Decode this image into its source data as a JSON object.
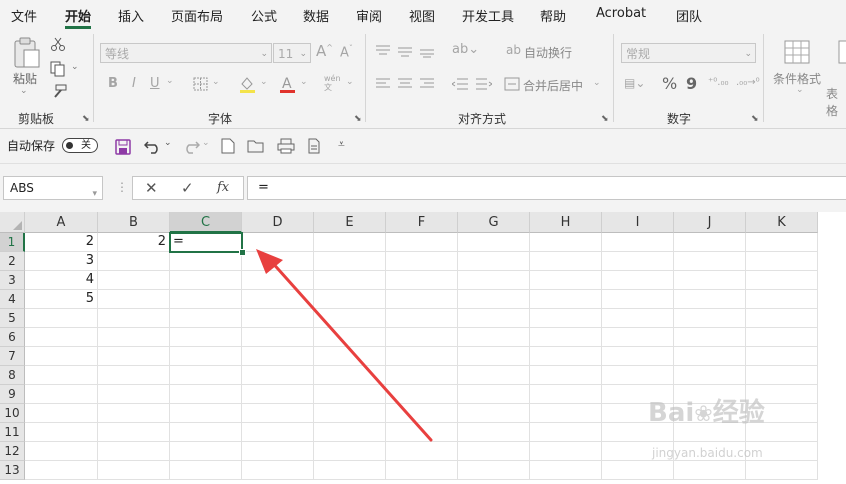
{
  "menu": {
    "items": [
      "文件",
      "开始",
      "插入",
      "页面布局",
      "公式",
      "数据",
      "审阅",
      "视图",
      "开发工具",
      "帮助",
      "Acrobat",
      "团队"
    ],
    "active": "开始"
  },
  "ribbon": {
    "clipboard": {
      "paste_label": "粘贴",
      "group_label": "剪贴板"
    },
    "font": {
      "font_name": "等线",
      "font_size": "11",
      "group_label": "字体",
      "bold": "B",
      "italic": "I",
      "underline": "U",
      "phonetic": "wén"
    },
    "alignment": {
      "wrap_text": "自动换行",
      "merge_center": "合并后居中",
      "group_label": "对齐方式"
    },
    "number": {
      "format": "常规",
      "percent": "%",
      "comma": "9",
      "group_label": "数字"
    },
    "styles": {
      "conditional_format": "条件格式",
      "table_format": "表格"
    }
  },
  "qat": {
    "autosave_label": "自动保存",
    "toggle_state": "关"
  },
  "formula_bar": {
    "name_box": "ABS",
    "fx": "fx",
    "formula": "="
  },
  "columns": [
    "A",
    "B",
    "C",
    "D",
    "E",
    "F",
    "G",
    "H",
    "I",
    "J",
    "K"
  ],
  "rows": [
    "1",
    "2",
    "3",
    "4",
    "5",
    "6",
    "7",
    "8",
    "9",
    "10",
    "11",
    "12",
    "13"
  ],
  "cells": {
    "A1": "2",
    "A2": "3",
    "A3": "4",
    "A4": "5",
    "B1": "2",
    "C1": "="
  },
  "selected": {
    "column": "C",
    "row": "1"
  },
  "annotation": {
    "color": "#e8403f"
  },
  "watermark": {
    "brand": "Bai",
    "brand_cn": "经验",
    "url": "jingyan.baidu.com"
  },
  "colors": {
    "accent": "#217346",
    "ribbon_bg": "#f3f3f3",
    "header_bg": "#e6e6e6"
  }
}
